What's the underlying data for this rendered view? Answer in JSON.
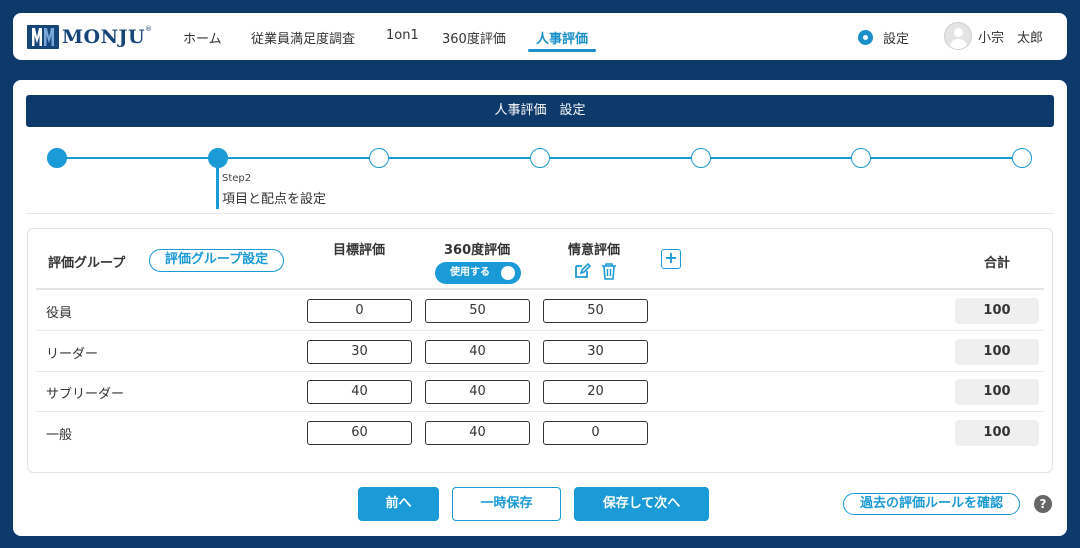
{
  "header": {
    "logo_text": "MONJU",
    "logo_reg": "®",
    "nav": [
      "ホーム",
      "従業員満足度調査",
      "1on1",
      "360度評価",
      "人事評価"
    ],
    "active_nav": "人事評価",
    "settings_label": "設定",
    "user_name": "小宗　太郎"
  },
  "page": {
    "title": "人事評価　設定"
  },
  "stepper": {
    "total_steps": 7,
    "current_step": 2,
    "step_label": "Step2",
    "step_title": "項目と配点を設定"
  },
  "table": {
    "group_header": "評価グループ",
    "group_settings_button": "評価グループ設定",
    "columns": [
      "目標評価",
      "360度評価",
      "情意評価"
    ],
    "toggle_label": "使用する",
    "toggle_on": true,
    "add_button": "+",
    "total_header": "合計",
    "rows": [
      {
        "group": "役員",
        "values": [
          "0",
          "50",
          "50"
        ],
        "total": "100"
      },
      {
        "group": "リーダー",
        "values": [
          "30",
          "40",
          "30"
        ],
        "total": "100"
      },
      {
        "group": "サブリーダー",
        "values": [
          "40",
          "40",
          "20"
        ],
        "total": "100"
      },
      {
        "group": "一般",
        "values": [
          "60",
          "40",
          "0"
        ],
        "total": "100"
      }
    ]
  },
  "footer": {
    "prev_button": "前へ",
    "temp_save_button": "一時保存",
    "save_next_button": "保存して次へ",
    "past_rules_button": "過去の評価ルールを確認",
    "help": "?"
  },
  "colors": {
    "navy": "#0e3a6b",
    "accent": "#1a9ad6"
  }
}
